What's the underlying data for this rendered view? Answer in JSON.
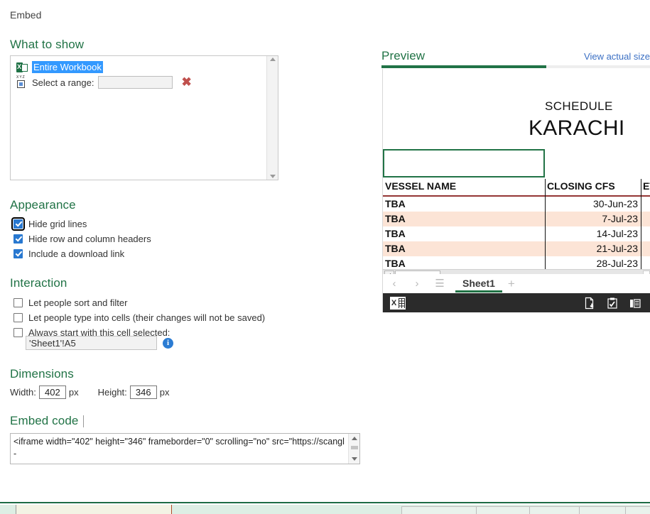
{
  "window": {
    "title": "Embed"
  },
  "what_to_show": {
    "heading": "What to show",
    "entire_workbook_label": "Entire Workbook",
    "select_range_label": "Select a range:",
    "range_value": "",
    "range_placeholder": "",
    "clear_icon": "red-x-icon",
    "workbook_icon": "excel-file-icon",
    "range_icon": "cell-range-icon"
  },
  "appearance": {
    "heading": "Appearance",
    "options": [
      {
        "label": "Hide grid lines",
        "checked": true,
        "focused": true
      },
      {
        "label": "Hide row and column headers",
        "checked": true,
        "focused": false
      },
      {
        "label": "Include a download link",
        "checked": true,
        "focused": false
      }
    ]
  },
  "interaction": {
    "heading": "Interaction",
    "options": [
      {
        "label": "Let people sort and filter",
        "checked": false
      },
      {
        "label": "Let people type into cells (their changes will not be saved)",
        "checked": false
      },
      {
        "label": "Always start with this cell selected:",
        "checked": false
      }
    ],
    "start_cell_value": "'Sheet1'!A5",
    "info_glyph": "i"
  },
  "dimensions": {
    "heading": "Dimensions",
    "width_label": "Width:",
    "width_value": "402",
    "width_unit": "px",
    "height_label": "Height:",
    "height_value": "346",
    "height_unit": "px"
  },
  "embed_code": {
    "heading": "Embed code",
    "value": "<iframe width=\"402\" height=\"346\" frameborder=\"0\" scrolling=\"no\" src=\"https://scangl-"
  },
  "preview": {
    "heading": "Preview",
    "view_actual_link": "View actual size",
    "progress_percent": 61,
    "sheet": {
      "title_line1": "SCHEDULE",
      "title_line2": "KARACHI",
      "columns": [
        "VESSEL NAME",
        "CLOSING CFS",
        "ETD"
      ],
      "rows": [
        {
          "vessel": "TBA",
          "closing_cfs": "30-Jun-23",
          "etd": ""
        },
        {
          "vessel": "TBA",
          "closing_cfs": "7-Jul-23",
          "etd": ""
        },
        {
          "vessel": "TBA",
          "closing_cfs": "14-Jul-23",
          "etd": ""
        },
        {
          "vessel": "TBA",
          "closing_cfs": "21-Jul-23",
          "etd": ""
        },
        {
          "vessel": "TBA",
          "closing_cfs": "28-Jul-23",
          "etd": ""
        }
      ]
    },
    "tabbar": {
      "prev_label": "‹",
      "next_label": "›",
      "menu_label": "☰",
      "active_sheet": "Sheet1",
      "add_label": "+"
    },
    "status_bar": {
      "brand_icon": "excel-logo-icon",
      "brand_letter": "X",
      "actions": [
        {
          "name": "download-icon"
        },
        {
          "name": "edit-workbook-icon"
        },
        {
          "name": "show-panel-icon"
        }
      ]
    }
  },
  "colors": {
    "accent_green": "#217346",
    "checkbox_blue": "#2878d0",
    "link_blue": "#3a6fc4",
    "row_highlight": "#fce4d6",
    "header_rule": "#943634",
    "status_bar": "#2b2b2b"
  }
}
